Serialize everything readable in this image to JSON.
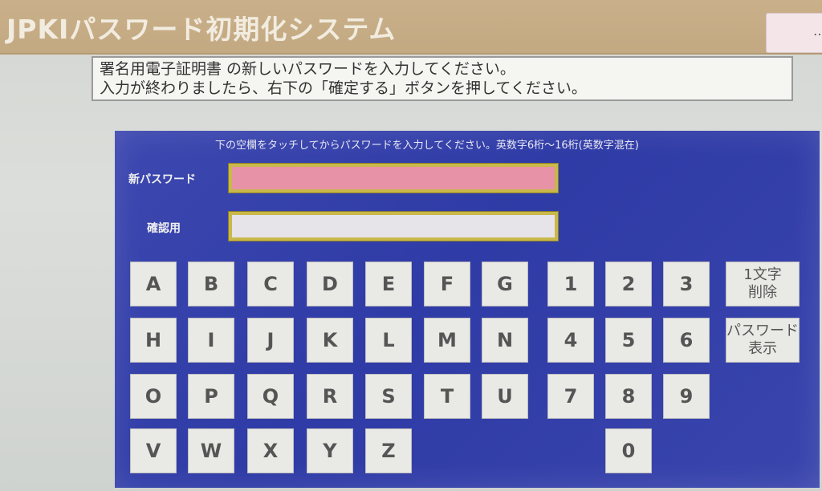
{
  "header": {
    "title": "JPKIパスワード初期化システム",
    "button_label": "…"
  },
  "instruction": {
    "line1": "署名用電子証明書 の新しいパスワードを入力してください。",
    "line2": "入力が終わりましたら、右下の「確定する」ボタンを押してください。"
  },
  "panel": {
    "hint": "下の空欄をタッチしてからパスワードを入力してください。英数字6桁〜16桁(英数字混在)",
    "new_password_label": "新パスワード",
    "confirm_label": "確認用",
    "new_password_value": "",
    "confirm_value": ""
  },
  "keys": {
    "A": "A",
    "B": "B",
    "C": "C",
    "D": "D",
    "E": "E",
    "F": "F",
    "G": "G",
    "H": "H",
    "I": "I",
    "J": "J",
    "K": "K",
    "L": "L",
    "M": "M",
    "N": "N",
    "O": "O",
    "P": "P",
    "Q": "Q",
    "R": "R",
    "S": "S",
    "T": "T",
    "U": "U",
    "V": "V",
    "W": "W",
    "X": "X",
    "Y": "Y",
    "Z": "Z",
    "n1": "1",
    "n2": "2",
    "n3": "3",
    "n4": "4",
    "n5": "5",
    "n6": "6",
    "n7": "7",
    "n8": "8",
    "n9": "9",
    "n0": "0",
    "delete_line1": "1文字",
    "delete_line2": "削除",
    "show_line1": "パスワード",
    "show_line2": "表示"
  }
}
